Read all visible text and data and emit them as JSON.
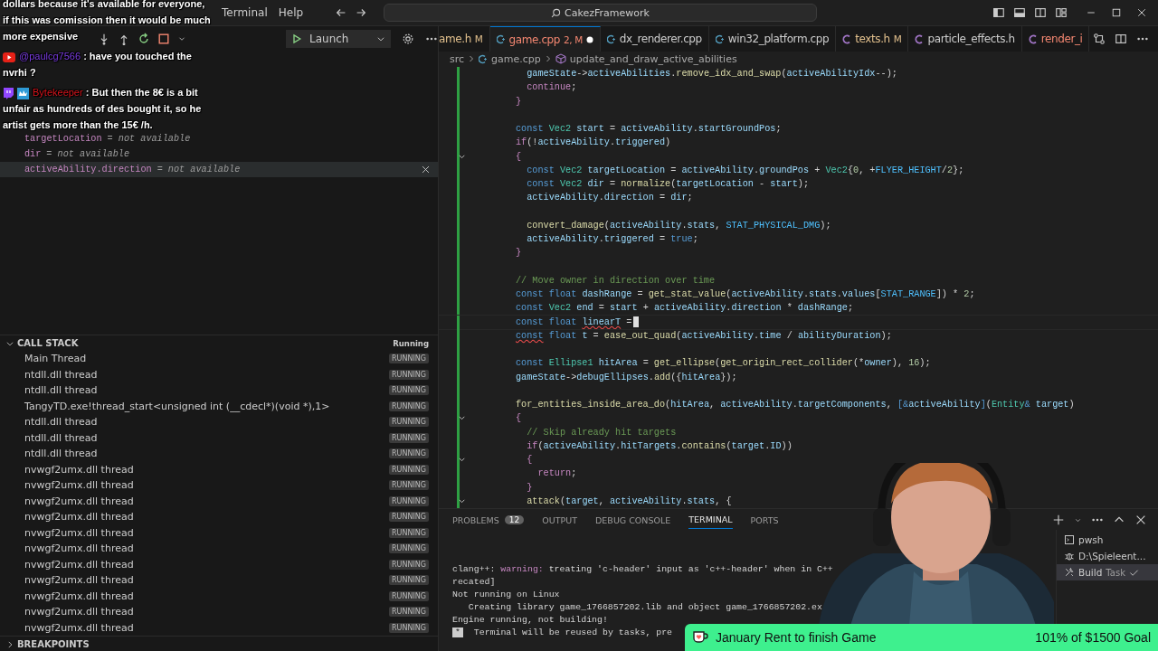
{
  "title_bar": {
    "menu": [
      "Terminal",
      "Help"
    ],
    "search": "CakezFramework"
  },
  "debug_toolbar": {
    "config": "Launch"
  },
  "variables": [
    {
      "name": "targetLocation",
      "value": "= not available",
      "selected": false
    },
    {
      "name": "dir",
      "value": "= not available",
      "selected": false
    },
    {
      "name": "activeAbility.direction",
      "value": "= not available",
      "selected": true
    }
  ],
  "call_stack": {
    "title": "CALL STACK",
    "status": "Running",
    "threads": [
      {
        "name": "Main Thread",
        "state": "RUNNING"
      },
      {
        "name": "ntdll.dll thread",
        "state": "RUNNING"
      },
      {
        "name": "ntdll.dll thread",
        "state": "RUNNING"
      },
      {
        "name": "TangyTD.exe!thread_start<unsigned int (__cdecl*)(void *),1>",
        "state": "RUNNING"
      },
      {
        "name": "ntdll.dll thread",
        "state": "RUNNING"
      },
      {
        "name": "ntdll.dll thread",
        "state": "RUNNING"
      },
      {
        "name": "ntdll.dll thread",
        "state": "RUNNING"
      },
      {
        "name": "nvwgf2umx.dll thread",
        "state": "RUNNING"
      },
      {
        "name": "nvwgf2umx.dll thread",
        "state": "RUNNING"
      },
      {
        "name": "nvwgf2umx.dll thread",
        "state": "RUNNING"
      },
      {
        "name": "nvwgf2umx.dll thread",
        "state": "RUNNING"
      },
      {
        "name": "nvwgf2umx.dll thread",
        "state": "RUNNING"
      },
      {
        "name": "nvwgf2umx.dll thread",
        "state": "RUNNING"
      },
      {
        "name": "nvwgf2umx.dll thread",
        "state": "RUNNING"
      },
      {
        "name": "nvwgf2umx.dll thread",
        "state": "RUNNING"
      },
      {
        "name": "nvwgf2umx.dll thread",
        "state": "RUNNING"
      },
      {
        "name": "nvwgf2umx.dll thread",
        "state": "RUNNING"
      },
      {
        "name": "nvwgf2umx.dll thread",
        "state": "RUNNING"
      }
    ]
  },
  "breakpoints": {
    "title": "BREAKPOINTS"
  },
  "editor_tabs": [
    {
      "label": "ame.h",
      "color": "#e2c08d",
      "badge": "M",
      "dirty": false,
      "selected": false
    },
    {
      "label": "game.cpp",
      "kind": "cpp",
      "color": "#f48771",
      "badge": "2, M",
      "dirty": true,
      "selected": true
    },
    {
      "label": "dx_renderer.cpp",
      "kind": "cpp",
      "color": "#cccccc",
      "dirty": false,
      "selected": false
    },
    {
      "label": "win32_platform.cpp",
      "kind": "cpp",
      "color": "#cccccc",
      "dirty": false,
      "selected": false
    },
    {
      "label": "texts.h",
      "kind": "header",
      "color": "#e2c08d",
      "badge": "M",
      "dirty": false,
      "selected": false
    },
    {
      "label": "particle_effects.h",
      "kind": "header",
      "color": "#cccccc",
      "dirty": false,
      "selected": false
    },
    {
      "label": "render_i",
      "kind": "header",
      "color": "#f48771",
      "dirty": false,
      "selected": false
    }
  ],
  "breadcrumb": [
    {
      "label": "src",
      "kind": "folder"
    },
    {
      "label": "game.cpp",
      "kind": "cpp"
    },
    {
      "label": "update_and_draw_active_abilities",
      "kind": "function"
    }
  ],
  "code_lines": [
    {
      "kind": "code",
      "tokens": [
        {
          "kind": "var",
          "text": "  gameState"
        },
        {
          "kind": "p",
          "text": "->"
        },
        {
          "kind": "var",
          "text": "activeAbilities"
        },
        {
          "kind": "p",
          "text": "."
        },
        {
          "kind": "fn",
          "text": "remove_idx_and_swap"
        },
        {
          "kind": "p",
          "text": "("
        },
        {
          "kind": "var",
          "text": "activeAbilityIdx"
        },
        {
          "kind": "p",
          "text": "--);"
        }
      ]
    },
    {
      "kind": "code",
      "tokens": [
        {
          "kind": "ctl",
          "text": "  continue"
        },
        {
          "kind": "p",
          "text": ";"
        }
      ]
    },
    {
      "kind": "code",
      "tokens": [
        {
          "kind": "ctl",
          "text": "}"
        }
      ]
    },
    {
      "kind": "blank"
    },
    {
      "kind": "code",
      "tokens": [
        {
          "kind": "kw",
          "text": "const "
        },
        {
          "kind": "type",
          "text": "Vec2 "
        },
        {
          "kind": "var",
          "text": "start"
        },
        {
          "kind": "p",
          "text": " = "
        },
        {
          "kind": "var",
          "text": "activeAbility"
        },
        {
          "kind": "p",
          "text": "."
        },
        {
          "kind": "var",
          "text": "startGroundPos"
        },
        {
          "kind": "p",
          "text": ";"
        }
      ]
    },
    {
      "kind": "code",
      "tokens": [
        {
          "kind": "ctl",
          "text": "if"
        },
        {
          "kind": "p",
          "text": "(!"
        },
        {
          "kind": "var",
          "text": "activeAbility"
        },
        {
          "kind": "p",
          "text": "."
        },
        {
          "kind": "var",
          "text": "triggered"
        },
        {
          "kind": "p",
          "text": ")"
        }
      ]
    },
    {
      "kind": "code",
      "fold": true,
      "tokens": [
        {
          "kind": "ctl",
          "text": "{"
        }
      ]
    },
    {
      "kind": "code",
      "tokens": [
        {
          "kind": "kw",
          "text": "  const "
        },
        {
          "kind": "type",
          "text": "Vec2 "
        },
        {
          "kind": "var",
          "text": "targetLocation"
        },
        {
          "kind": "p",
          "text": " = "
        },
        {
          "kind": "var",
          "text": "activeAbility"
        },
        {
          "kind": "p",
          "text": "."
        },
        {
          "kind": "var",
          "text": "groundPos"
        },
        {
          "kind": "p",
          "text": " + "
        },
        {
          "kind": "type",
          "text": "Vec2"
        },
        {
          "kind": "p",
          "text": "{"
        },
        {
          "kind": "num",
          "text": "0"
        },
        {
          "kind": "p",
          "text": ", +"
        },
        {
          "kind": "mac",
          "text": "FLYER_HEIGHT"
        },
        {
          "kind": "p",
          "text": "/"
        },
        {
          "kind": "num",
          "text": "2"
        },
        {
          "kind": "p",
          "text": "};"
        }
      ]
    },
    {
      "kind": "code",
      "tokens": [
        {
          "kind": "kw",
          "text": "  const "
        },
        {
          "kind": "type",
          "text": "Vec2 "
        },
        {
          "kind": "var",
          "text": "dir"
        },
        {
          "kind": "p",
          "text": " = "
        },
        {
          "kind": "fn",
          "text": "normalize"
        },
        {
          "kind": "p",
          "text": "("
        },
        {
          "kind": "var",
          "text": "targetLocation"
        },
        {
          "kind": "p",
          "text": " - "
        },
        {
          "kind": "var",
          "text": "start"
        },
        {
          "kind": "p",
          "text": ");"
        }
      ]
    },
    {
      "kind": "code",
      "tokens": [
        {
          "kind": "var",
          "text": "  activeAbility"
        },
        {
          "kind": "p",
          "text": "."
        },
        {
          "kind": "var",
          "text": "direction"
        },
        {
          "kind": "p",
          "text": " = "
        },
        {
          "kind": "var",
          "text": "dir"
        },
        {
          "kind": "p",
          "text": ";"
        }
      ]
    },
    {
      "kind": "blank"
    },
    {
      "kind": "code",
      "tokens": [
        {
          "kind": "fn",
          "text": "  convert_damage"
        },
        {
          "kind": "p",
          "text": "("
        },
        {
          "kind": "var",
          "text": "activeAbility"
        },
        {
          "kind": "p",
          "text": "."
        },
        {
          "kind": "var",
          "text": "stats"
        },
        {
          "kind": "p",
          "text": ", "
        },
        {
          "kind": "mac",
          "text": "STAT_PHYSICAL_DMG"
        },
        {
          "kind": "p",
          "text": ");"
        }
      ]
    },
    {
      "kind": "code",
      "tokens": [
        {
          "kind": "var",
          "text": "  activeAbility"
        },
        {
          "kind": "p",
          "text": "."
        },
        {
          "kind": "var",
          "text": "triggered"
        },
        {
          "kind": "p",
          "text": " = "
        },
        {
          "kind": "kw",
          "text": "true"
        },
        {
          "kind": "p",
          "text": ";"
        }
      ]
    },
    {
      "kind": "code",
      "tokens": [
        {
          "kind": "ctl",
          "text": "}"
        }
      ]
    },
    {
      "kind": "blank"
    },
    {
      "kind": "code",
      "tokens": [
        {
          "kind": "com",
          "text": "// Move owner in direction over time"
        }
      ]
    },
    {
      "kind": "code",
      "tokens": [
        {
          "kind": "kw",
          "text": "const float "
        },
        {
          "kind": "var",
          "text": "dashRange"
        },
        {
          "kind": "p",
          "text": " = "
        },
        {
          "kind": "fn",
          "text": "get_stat_value"
        },
        {
          "kind": "p",
          "text": "("
        },
        {
          "kind": "var",
          "text": "activeAbility"
        },
        {
          "kind": "p",
          "text": "."
        },
        {
          "kind": "var",
          "text": "stats"
        },
        {
          "kind": "p",
          "text": "."
        },
        {
          "kind": "var",
          "text": "values"
        },
        {
          "kind": "p",
          "text": "["
        },
        {
          "kind": "mac",
          "text": "STAT_RANGE"
        },
        {
          "kind": "p",
          "text": "]) * "
        },
        {
          "kind": "num",
          "text": "2"
        },
        {
          "kind": "p",
          "text": ";"
        }
      ]
    },
    {
      "kind": "code",
      "tokens": [
        {
          "kind": "kw",
          "text": "const "
        },
        {
          "kind": "type",
          "text": "Vec2 "
        },
        {
          "kind": "var",
          "text": "end"
        },
        {
          "kind": "p",
          "text": " = "
        },
        {
          "kind": "var",
          "text": "start"
        },
        {
          "kind": "p",
          "text": " + "
        },
        {
          "kind": "var",
          "text": "activeAbility"
        },
        {
          "kind": "p",
          "text": "."
        },
        {
          "kind": "var",
          "text": "direction"
        },
        {
          "kind": "p",
          "text": " * "
        },
        {
          "kind": "var",
          "text": "dashRange"
        },
        {
          "kind": "p",
          "text": ";"
        }
      ]
    },
    {
      "kind": "code",
      "current": true,
      "tokens": [
        {
          "kind": "kw",
          "text": "const float "
        },
        {
          "kind": "var",
          "text": "linearT",
          "error": true
        },
        {
          "kind": "p",
          "text": " ="
        }
      ]
    },
    {
      "kind": "code",
      "tokens": [
        {
          "kind": "kw",
          "text": "const",
          "error": true
        },
        {
          "kind": "kw",
          "text": " float "
        },
        {
          "kind": "var",
          "text": "t"
        },
        {
          "kind": "p",
          "text": " = "
        },
        {
          "kind": "fn",
          "text": "ease_out_quad"
        },
        {
          "kind": "p",
          "text": "("
        },
        {
          "kind": "var",
          "text": "activeAbility"
        },
        {
          "kind": "p",
          "text": "."
        },
        {
          "kind": "var",
          "text": "time"
        },
        {
          "kind": "p",
          "text": " / "
        },
        {
          "kind": "var",
          "text": "abilityDuration"
        },
        {
          "kind": "p",
          "text": ");"
        }
      ]
    },
    {
      "kind": "blank"
    },
    {
      "kind": "code",
      "tokens": [
        {
          "kind": "kw",
          "text": "const "
        },
        {
          "kind": "type",
          "text": "Ellipse1 "
        },
        {
          "kind": "var",
          "text": "hitArea"
        },
        {
          "kind": "p",
          "text": " = "
        },
        {
          "kind": "fn",
          "text": "get_ellipse"
        },
        {
          "kind": "p",
          "text": "("
        },
        {
          "kind": "fn",
          "text": "get_origin_rect_collider"
        },
        {
          "kind": "p",
          "text": "(*"
        },
        {
          "kind": "var",
          "text": "owner"
        },
        {
          "kind": "p",
          "text": "), "
        },
        {
          "kind": "num",
          "text": "16"
        },
        {
          "kind": "p",
          "text": ");"
        }
      ]
    },
    {
      "kind": "code",
      "tokens": [
        {
          "kind": "var",
          "text": "gameState"
        },
        {
          "kind": "p",
          "text": "->"
        },
        {
          "kind": "var",
          "text": "debugEllipses"
        },
        {
          "kind": "p",
          "text": "."
        },
        {
          "kind": "fn",
          "text": "add"
        },
        {
          "kind": "p",
          "text": "({"
        },
        {
          "kind": "var",
          "text": "hitArea"
        },
        {
          "kind": "p",
          "text": "});"
        }
      ]
    },
    {
      "kind": "blank"
    },
    {
      "kind": "code",
      "tokens": [
        {
          "kind": "fn",
          "text": "for_entities_inside_area_do"
        },
        {
          "kind": "p",
          "text": "("
        },
        {
          "kind": "var",
          "text": "hitArea"
        },
        {
          "kind": "p",
          "text": ", "
        },
        {
          "kind": "var",
          "text": "activeAbility"
        },
        {
          "kind": "p",
          "text": "."
        },
        {
          "kind": "var",
          "text": "targetComponents"
        },
        {
          "kind": "p",
          "text": ", "
        },
        {
          "kind": "kw",
          "text": "[&"
        },
        {
          "kind": "var",
          "text": "activeAbility"
        },
        {
          "kind": "kw",
          "text": "]"
        },
        {
          "kind": "p",
          "text": "("
        },
        {
          "kind": "type",
          "text": "Entity"
        },
        {
          "kind": "kw",
          "text": "& "
        },
        {
          "kind": "var",
          "text": "target"
        },
        {
          "kind": "p",
          "text": ")"
        }
      ]
    },
    {
      "kind": "code",
      "fold": true,
      "tokens": [
        {
          "kind": "ctl",
          "text": "{"
        }
      ]
    },
    {
      "kind": "code",
      "tokens": [
        {
          "kind": "com",
          "text": "  // Skip already hit targets"
        }
      ]
    },
    {
      "kind": "code",
      "tokens": [
        {
          "kind": "ctl",
          "text": "  if"
        },
        {
          "kind": "p",
          "text": "("
        },
        {
          "kind": "var",
          "text": "activeAbility"
        },
        {
          "kind": "p",
          "text": "."
        },
        {
          "kind": "var",
          "text": "hitTargets"
        },
        {
          "kind": "p",
          "text": "."
        },
        {
          "kind": "fn",
          "text": "contains"
        },
        {
          "kind": "p",
          "text": "("
        },
        {
          "kind": "var",
          "text": "target"
        },
        {
          "kind": "p",
          "text": "."
        },
        {
          "kind": "var",
          "text": "ID"
        },
        {
          "kind": "p",
          "text": "))"
        }
      ]
    },
    {
      "kind": "code",
      "fold": true,
      "tokens": [
        {
          "kind": "ctl",
          "text": "  {"
        }
      ]
    },
    {
      "kind": "code",
      "tokens": [
        {
          "kind": "ctl",
          "text": "    return"
        },
        {
          "kind": "p",
          "text": ";"
        }
      ]
    },
    {
      "kind": "code",
      "tokens": [
        {
          "kind": "ctl",
          "text": "  }"
        }
      ]
    },
    {
      "kind": "code",
      "fold": true,
      "tokens": [
        {
          "kind": "fn",
          "text": "  attack"
        },
        {
          "kind": "p",
          "text": "("
        },
        {
          "kind": "var",
          "text": "target"
        },
        {
          "kind": "p",
          "text": ", "
        },
        {
          "kind": "var",
          "text": "activeAbility"
        },
        {
          "kind": "p",
          "text": "."
        },
        {
          "kind": "var",
          "text": "stats"
        },
        {
          "kind": "p",
          "text": ", {"
        }
      ]
    }
  ],
  "panel_tabs": [
    {
      "label": "PROBLEMS",
      "badge": "12",
      "selected": false
    },
    {
      "label": "OUTPUT",
      "selected": false
    },
    {
      "label": "DEBUG CONSOLE",
      "selected": false
    },
    {
      "label": "TERMINAL",
      "selected": true
    },
    {
      "label": "PORTS",
      "selected": false
    }
  ],
  "terminal_lines": [
    {
      "tokens": [
        {
          "kind": "p",
          "text": "clang++: "
        },
        {
          "kind": "warn",
          "text": "warning:"
        },
        {
          "kind": "p",
          "text": " treating 'c-header' input as 'c++-header' when in C++"
        }
      ]
    },
    {
      "tokens": [
        {
          "kind": "p",
          "text": "recated]"
        }
      ]
    },
    {
      "tokens": [
        {
          "kind": "p",
          "text": "Not running on Linux"
        }
      ]
    },
    {
      "tokens": [
        {
          "kind": "p",
          "text": "   Creating library game_1766857202.lib and object game_1766857202.ex"
        }
      ]
    },
    {
      "tokens": [
        {
          "kind": "p",
          "text": "Engine running, not building!"
        }
      ]
    },
    {
      "tokens": [
        {
          "kind": "box",
          "text": "*"
        },
        {
          "kind": "p",
          "text": "  Terminal will be reused by tasks, pre"
        }
      ]
    }
  ],
  "terminals": [
    {
      "label": "pwsh",
      "kind": "shell",
      "selected": false
    },
    {
      "label": "D:\\Spieleent...",
      "kind": "debug",
      "selected": false
    },
    {
      "label": "Build",
      "kind": "task",
      "tag": "Task",
      "selected": true
    }
  ],
  "chat": [
    {
      "kind": "none",
      "lines": [
        "dollars because it's available for everyone,",
        "if this was comission then it would be much",
        "more expensive"
      ]
    },
    {
      "kind": "youtube",
      "author": "@paulcg7566",
      "color": "#7a3ce0",
      "lines": [
        ": have you touched the",
        "nvrhi ?"
      ]
    },
    {
      "kind": "twitch",
      "author": "Bytekeeper",
      "color": "#d8141c",
      "lines": [
        ": But then the 8€ is a bit",
        "unfair as hundreds of des bought it, so he",
        "artist gets more than the 15€ /h."
      ]
    }
  ],
  "goal": {
    "title": "January Rent to finish Game",
    "progress": "101% of $1500 Goal",
    "level": 1
  }
}
